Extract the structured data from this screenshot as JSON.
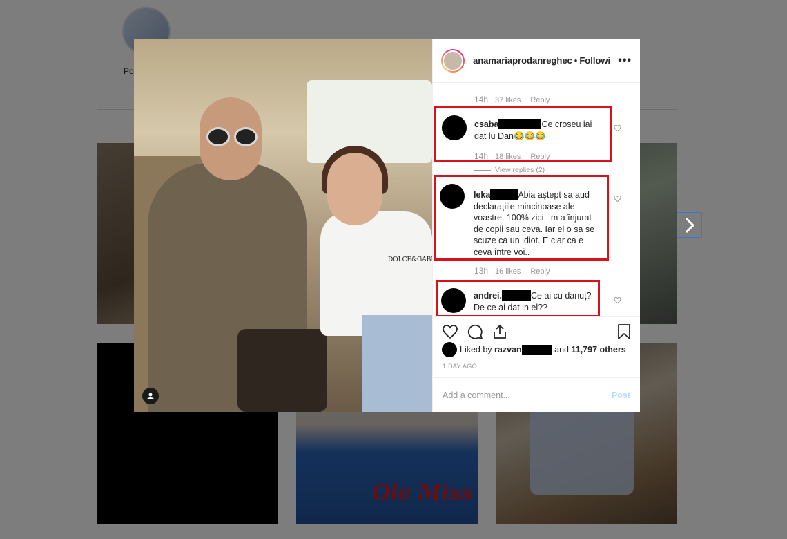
{
  "background": {
    "posts_label": "Po"
  },
  "post": {
    "username": "anamariaprodanreghec",
    "separator": "•",
    "follow_status": "Following",
    "more": "•••",
    "shirt_text": "DOLCE&GABBA"
  },
  "comments": {
    "prev_meta": {
      "time": "14h",
      "likes": "37 likes",
      "reply": "Reply"
    },
    "items": [
      {
        "user": "csaba",
        "text": "Ce croseu iai dat lu Dan😂😂😂",
        "time": "14h",
        "likes": "18 likes",
        "reply": "Reply"
      },
      {
        "user": "leka",
        "text": "Abia aștept sa aud declarațiile mincinoase ale voastre. 100% zici : m a înjurat de copii sau ceva. Iar el o sa se scuze ca un idiot. E clar ca e ceva între voi..",
        "time": "13h",
        "likes": "16 likes",
        "reply": "Reply"
      },
      {
        "user": "andrei.",
        "text": "Ce ai cu danuț? De ce ai dat in el??"
      }
    ],
    "view_replies": "View replies (2)"
  },
  "likes": {
    "prefix": "Liked by",
    "user": "razvan",
    "and": "and",
    "others": "11,797 others"
  },
  "date": "1 DAY AGO",
  "add_comment": {
    "placeholder": "Add a comment...",
    "post_label": "Post"
  },
  "colors": {
    "highlight_box": "#d8121c",
    "post_button": "#b3dbff"
  }
}
